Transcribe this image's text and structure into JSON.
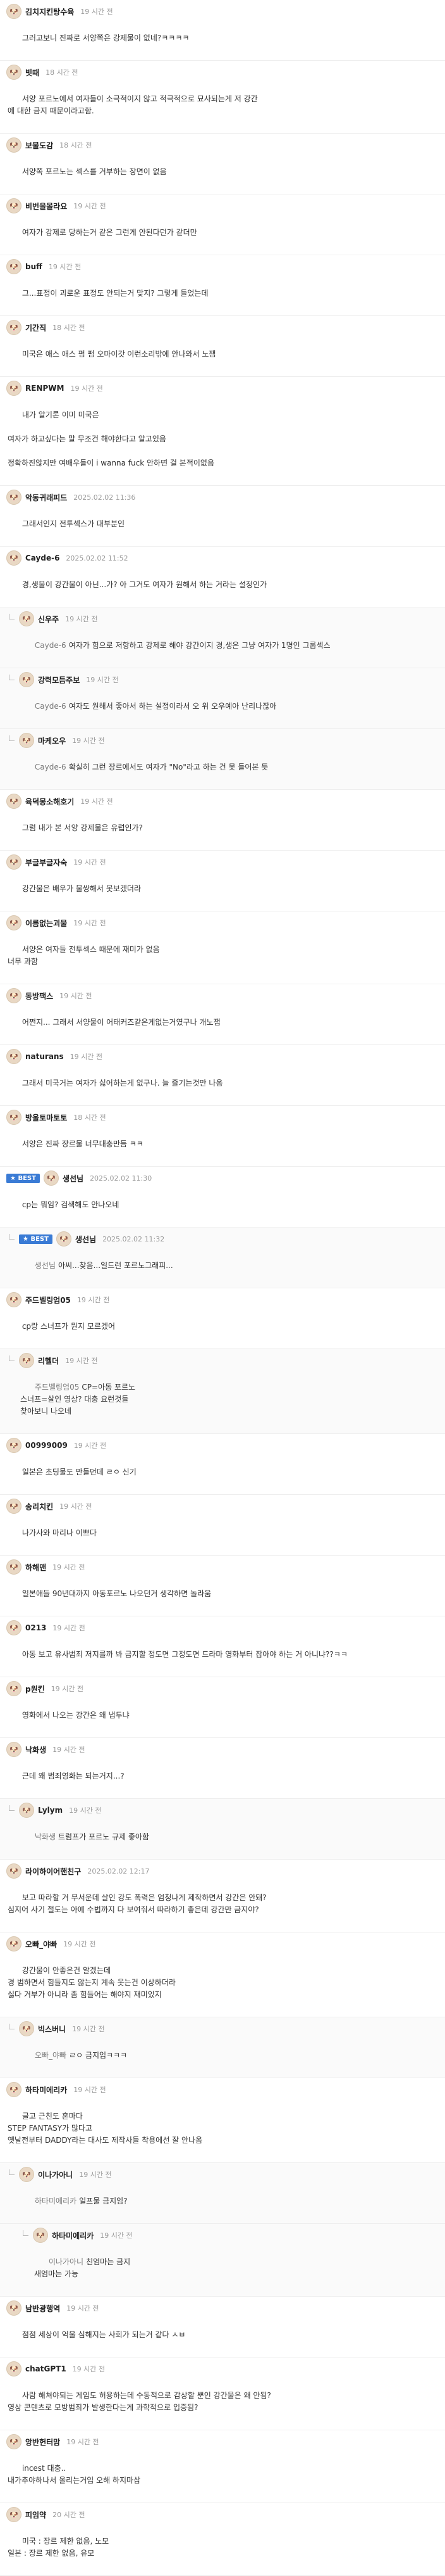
{
  "comments": [
    {
      "nick": "김치지킨탕수육",
      "time": "19 시간 전",
      "body": "그러고보니 진짜로 서양쪽은 강제물이 없네?ㅋㅋㅋㅋ",
      "badge": "",
      "mention": "",
      "indent": 0
    },
    {
      "nick": "빗때",
      "time": "18 시간 전",
      "body": "서양 포르노에서 여자들이 소극적이지 않고 적극적으로 묘사되는게 저 강간\n에 대한 금지 때문이라고함.",
      "badge": "",
      "mention": "",
      "indent": 0
    },
    {
      "nick": "보물도감",
      "time": "18 시간 전",
      "body": "서양쪽 포르노는 섹스를 거부하는 장면이 없음",
      "badge": "",
      "mention": "",
      "indent": 0
    },
    {
      "nick": "비번을몰라요",
      "time": "19 시간 전",
      "body": "여자가 강제로 당하는거 같은 그런게 안된다던가 같더만",
      "badge": "",
      "mention": "",
      "indent": 0
    },
    {
      "nick": "buff",
      "time": "19 시간 전",
      "body": "그...표정이 괴로운 표정도 안되는거 맞지? 그렇게 들었는데",
      "badge": "",
      "mention": "",
      "indent": 0
    },
    {
      "nick": "기간직",
      "time": "18 시간 전",
      "body": "미국은 애스 애스 펌 펌 오마이갓 이런소리밖에 안나와서 노잼",
      "badge": "",
      "mention": "",
      "indent": 0
    },
    {
      "nick": "RENPWM",
      "time": "19 시간 전",
      "body": "내가 알기론 이미 미국은\n\n여자가 하고싶다는 말 무조건 해야한다고 알고있음\n\n정확하진않지만 여배우들이 i wanna fuck 안하면 걸 본적이없음",
      "badge": "",
      "mention": "",
      "indent": 0
    },
    {
      "nick": "악동귀래피드",
      "time": "2025.02.02 11:36",
      "body": "그래서인지 전투섹스가 대부분인",
      "badge": "",
      "mention": "",
      "indent": 0
    },
    {
      "nick": "Cayde-6",
      "time": "2025.02.02 11:52",
      "body": "경,생물이 강간물이 아닌...가? 아 그거도 여자가 원해서 하는 거라는 설정인가",
      "badge": "",
      "mention": "",
      "indent": 0
    },
    {
      "nick": "신우주",
      "time": "19 시간 전",
      "body": "여자가 힘으로 저항하고 강제로 해야 강간이지 경,생은 그냥 여자가 1명인 그룹섹스",
      "badge": "",
      "mention": "Cayde-6",
      "indent": 1
    },
    {
      "nick": "강력모듬주보",
      "time": "19 시간 전",
      "body": "여자도 원해서 좋아서 하는 설정이라서 오 위 오우예아 난리나잖아",
      "badge": "",
      "mention": "Cayde-6",
      "indent": 1
    },
    {
      "nick": "마케오우",
      "time": "19 시간 전",
      "body": "확실히 그런 장르에서도 여자가 \"No\"라고 하는 건 못 들어본 듯",
      "badge": "",
      "mention": "Cayde-6",
      "indent": 1
    },
    {
      "nick": "육덕몽소해호기",
      "time": "19 시간 전",
      "body": "그럼 내가 본 서양 강제물은 유럽인가?",
      "badge": "",
      "mention": "",
      "indent": 0
    },
    {
      "nick": "부글부글자숙",
      "time": "19 시간 전",
      "body": "강간물은 배우가 불쌍해서 못보겠더라",
      "badge": "",
      "mention": "",
      "indent": 0
    },
    {
      "nick": "이름없는괴물",
      "time": "19 시간 전",
      "body": "서양은 여자들 전투섹스 때문에 재미가 없음\n너무 과함",
      "badge": "",
      "mention": "",
      "indent": 0
    },
    {
      "nick": "동방팩스",
      "time": "19 시간 전",
      "body": "어쩐지... 그래서 서양물이 어태커즈같은게없는거였구나 개노잼",
      "badge": "",
      "mention": "",
      "indent": 0
    },
    {
      "nick": "naturans",
      "time": "19 시간 전",
      "body": "그래서 미국거는 여자가 싫어하는게 없구나. 늘 즐기는것만 나옴",
      "badge": "",
      "mention": "",
      "indent": 0
    },
    {
      "nick": "방울토마토토",
      "time": "18 시간 전",
      "body": "서양은 진짜 장르물 너무대충만듬 ㅋㅋ",
      "badge": "",
      "mention": "",
      "indent": 0
    },
    {
      "nick": "생선님",
      "time": "2025.02.02 11:30",
      "body": "cp는 뭐임? 검색해도 안나오네",
      "badge": "BEST",
      "mention": "",
      "indent": 0
    },
    {
      "nick": "생선님",
      "time": "2025.02.02 11:32",
      "body": "아씨...찾음...일드런 포르노그래피...",
      "badge": "BEST",
      "mention": "생선님",
      "indent": 1
    },
    {
      "nick": "주드벨링엄05",
      "time": "19 시간 전",
      "body": "cp랑 스너프가 뭔지 모르겠어",
      "badge": "",
      "mention": "",
      "indent": 0
    },
    {
      "nick": "리헬더",
      "time": "19 시간 전",
      "body": "CP=아동 포르노\n스너프=살인 영상? 대충 요런것들\n찾아보니 나오네",
      "badge": "",
      "mention": "주드벨링엄05",
      "indent": 1
    },
    {
      "nick": "00999009",
      "time": "19 시간 전",
      "body": "일본은 초딩물도 만들던데 ㄹㅇ 신기",
      "badge": "",
      "mention": "",
      "indent": 0
    },
    {
      "nick": "송리치킨",
      "time": "19 시간 전",
      "body": "나가사와 마리나 이쁘다",
      "badge": "",
      "mention": "",
      "indent": 0
    },
    {
      "nick": "하해맨",
      "time": "19 시간 전",
      "body": "일본애들 90년대까지 아동포르노 나오던거 생각하면 놀라움",
      "badge": "",
      "mention": "",
      "indent": 0
    },
    {
      "nick": "0213",
      "time": "19 시간 전",
      "body": "아동 보고 유사범죄 저지를까 봐 금지할 정도면 그정도면 드라마 영화부터 잡아야 하는 거 아니냐??ㅋㅋ",
      "badge": "",
      "mention": "",
      "indent": 0
    },
    {
      "nick": "p원킨",
      "time": "19 시간 전",
      "body": "영화에서 나오는 강간은 왜 냅두냐",
      "badge": "",
      "mention": "",
      "indent": 0
    },
    {
      "nick": "낙화생",
      "time": "19 시간 전",
      "body": "근데 왜 범죄영화는 되는거지...?",
      "badge": "",
      "mention": "",
      "indent": 0
    },
    {
      "nick": "Lylym",
      "time": "19 시간 전",
      "body": "트럼프가 포르노 규제 좋아함",
      "badge": "",
      "mention": "낙화생",
      "indent": 1
    },
    {
      "nick": "라이하이어핸친구",
      "time": "2025.02.02 12:17",
      "body": "보고 따라할 거 무서운데 살인 강도 폭력은 엄청나게 제작하면서 강간은 안돼?\n심지어 사기 절도는 아예 수법까지 다 보여줘서 따라하기 좋은데 강간만 금지야?",
      "badge": "",
      "mention": "",
      "indent": 0
    },
    {
      "nick": "오빠_야빠",
      "time": "19 시간 전",
      "body": "강간물이 안좋은건 알겠는데\n경 범하면서 힘들지도 않는지 계속 웃는건 이상하더라\n싫다 거부가 아니라 좀 힘들어는 해야지 재미있지",
      "badge": "",
      "mention": "",
      "indent": 0
    },
    {
      "nick": "빅스버니",
      "time": "19 시간 전",
      "body": "ㄹㅇ 금지임ㅋㅋㅋ",
      "badge": "",
      "mention": "오빠_야빠",
      "indent": 1
    },
    {
      "nick": "하타미에리카",
      "time": "19 시간 전",
      "body": "글고 근친도 혼마다\nSTEP FANTASY가 많다고\n옛날전부터 DADDY라는 대사도 제작사들 착용에선 잘 안나옴",
      "badge": "",
      "mention": "",
      "indent": 0
    },
    {
      "nick": "이나가아니",
      "time": "19 시간 전",
      "body": "일프물 금지임?",
      "badge": "",
      "mention": "하타미에리카",
      "indent": 1
    },
    {
      "nick": "하타미에리카",
      "time": "19 시간 전",
      "body": "친엄마는 금지\n새엄마는 가능",
      "badge": "",
      "mention": "이나가아니",
      "indent": 2
    },
    {
      "nick": "남반광행역",
      "time": "19 시간 전",
      "body": "점점 세상이 억울 심해지는 사회가 되는거 같다 ㅅㅂ",
      "badge": "",
      "mention": "",
      "indent": 0
    },
    {
      "nick": "chatGPT1",
      "time": "19 시간 전",
      "body": "사람 해쳐야되는 게임도 허용하는데 수동적으로 감상할 뿐인 강간물은 왜 안됨?\n영상 콘텐츠로 모방범죄가 발생한다는게 과학적으로 입증됨?",
      "badge": "",
      "mention": "",
      "indent": 0
    },
    {
      "nick": "앙반헌터맘",
      "time": "19 시간 전",
      "body": "incest 대충..\n내가추야하나서 올리는거임 오해 하지마삼",
      "badge": "",
      "mention": "",
      "indent": 0
    },
    {
      "nick": "피임약",
      "time": "20 시간 전",
      "body": "미국 : 장르 제한 없음, 노모\n일본 : 장르 제한 없음, 유모",
      "badge": "",
      "mention": "",
      "indent": 0
    }
  ],
  "icons": {
    "reply": "reply-arrow-icon",
    "avatar": "avatar-icon"
  },
  "colors": {
    "badge": "#3a7bd5",
    "time": "#9a9a9a",
    "border": "#eeeeee"
  }
}
